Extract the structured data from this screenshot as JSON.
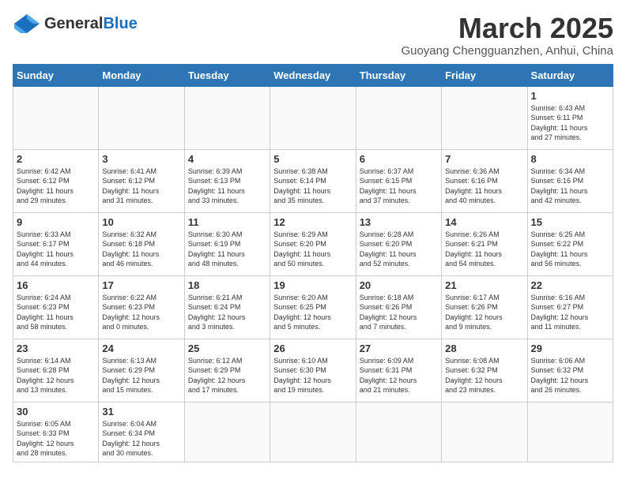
{
  "header": {
    "logo_general": "General",
    "logo_blue": "Blue",
    "month_title": "March 2025",
    "subtitle": "Guoyang Chengguanzhen, Anhui, China"
  },
  "days_of_week": [
    "Sunday",
    "Monday",
    "Tuesday",
    "Wednesday",
    "Thursday",
    "Friday",
    "Saturday"
  ],
  "weeks": [
    [
      {
        "day": "",
        "info": ""
      },
      {
        "day": "",
        "info": ""
      },
      {
        "day": "",
        "info": ""
      },
      {
        "day": "",
        "info": ""
      },
      {
        "day": "",
        "info": ""
      },
      {
        "day": "",
        "info": ""
      },
      {
        "day": "1",
        "info": "Sunrise: 6:43 AM\nSunset: 6:11 PM\nDaylight: 11 hours\nand 27 minutes."
      }
    ],
    [
      {
        "day": "2",
        "info": "Sunrise: 6:42 AM\nSunset: 6:12 PM\nDaylight: 11 hours\nand 29 minutes."
      },
      {
        "day": "3",
        "info": "Sunrise: 6:41 AM\nSunset: 6:12 PM\nDaylight: 11 hours\nand 31 minutes."
      },
      {
        "day": "4",
        "info": "Sunrise: 6:39 AM\nSunset: 6:13 PM\nDaylight: 11 hours\nand 33 minutes."
      },
      {
        "day": "5",
        "info": "Sunrise: 6:38 AM\nSunset: 6:14 PM\nDaylight: 11 hours\nand 35 minutes."
      },
      {
        "day": "6",
        "info": "Sunrise: 6:37 AM\nSunset: 6:15 PM\nDaylight: 11 hours\nand 37 minutes."
      },
      {
        "day": "7",
        "info": "Sunrise: 6:36 AM\nSunset: 6:16 PM\nDaylight: 11 hours\nand 40 minutes."
      },
      {
        "day": "8",
        "info": "Sunrise: 6:34 AM\nSunset: 6:16 PM\nDaylight: 11 hours\nand 42 minutes."
      }
    ],
    [
      {
        "day": "9",
        "info": "Sunrise: 6:33 AM\nSunset: 6:17 PM\nDaylight: 11 hours\nand 44 minutes."
      },
      {
        "day": "10",
        "info": "Sunrise: 6:32 AM\nSunset: 6:18 PM\nDaylight: 11 hours\nand 46 minutes."
      },
      {
        "day": "11",
        "info": "Sunrise: 6:30 AM\nSunset: 6:19 PM\nDaylight: 11 hours\nand 48 minutes."
      },
      {
        "day": "12",
        "info": "Sunrise: 6:29 AM\nSunset: 6:20 PM\nDaylight: 11 hours\nand 50 minutes."
      },
      {
        "day": "13",
        "info": "Sunrise: 6:28 AM\nSunset: 6:20 PM\nDaylight: 11 hours\nand 52 minutes."
      },
      {
        "day": "14",
        "info": "Sunrise: 6:26 AM\nSunset: 6:21 PM\nDaylight: 11 hours\nand 54 minutes."
      },
      {
        "day": "15",
        "info": "Sunrise: 6:25 AM\nSunset: 6:22 PM\nDaylight: 11 hours\nand 56 minutes."
      }
    ],
    [
      {
        "day": "16",
        "info": "Sunrise: 6:24 AM\nSunset: 6:23 PM\nDaylight: 11 hours\nand 58 minutes."
      },
      {
        "day": "17",
        "info": "Sunrise: 6:22 AM\nSunset: 6:23 PM\nDaylight: 12 hours\nand 0 minutes."
      },
      {
        "day": "18",
        "info": "Sunrise: 6:21 AM\nSunset: 6:24 PM\nDaylight: 12 hours\nand 3 minutes."
      },
      {
        "day": "19",
        "info": "Sunrise: 6:20 AM\nSunset: 6:25 PM\nDaylight: 12 hours\nand 5 minutes."
      },
      {
        "day": "20",
        "info": "Sunrise: 6:18 AM\nSunset: 6:26 PM\nDaylight: 12 hours\nand 7 minutes."
      },
      {
        "day": "21",
        "info": "Sunrise: 6:17 AM\nSunset: 6:26 PM\nDaylight: 12 hours\nand 9 minutes."
      },
      {
        "day": "22",
        "info": "Sunrise: 6:16 AM\nSunset: 6:27 PM\nDaylight: 12 hours\nand 11 minutes."
      }
    ],
    [
      {
        "day": "23",
        "info": "Sunrise: 6:14 AM\nSunset: 6:28 PM\nDaylight: 12 hours\nand 13 minutes."
      },
      {
        "day": "24",
        "info": "Sunrise: 6:13 AM\nSunset: 6:29 PM\nDaylight: 12 hours\nand 15 minutes."
      },
      {
        "day": "25",
        "info": "Sunrise: 6:12 AM\nSunset: 6:29 PM\nDaylight: 12 hours\nand 17 minutes."
      },
      {
        "day": "26",
        "info": "Sunrise: 6:10 AM\nSunset: 6:30 PM\nDaylight: 12 hours\nand 19 minutes."
      },
      {
        "day": "27",
        "info": "Sunrise: 6:09 AM\nSunset: 6:31 PM\nDaylight: 12 hours\nand 21 minutes."
      },
      {
        "day": "28",
        "info": "Sunrise: 6:08 AM\nSunset: 6:32 PM\nDaylight: 12 hours\nand 23 minutes."
      },
      {
        "day": "29",
        "info": "Sunrise: 6:06 AM\nSunset: 6:32 PM\nDaylight: 12 hours\nand 26 minutes."
      }
    ],
    [
      {
        "day": "30",
        "info": "Sunrise: 6:05 AM\nSunset: 6:33 PM\nDaylight: 12 hours\nand 28 minutes."
      },
      {
        "day": "31",
        "info": "Sunrise: 6:04 AM\nSunset: 6:34 PM\nDaylight: 12 hours\nand 30 minutes."
      },
      {
        "day": "",
        "info": ""
      },
      {
        "day": "",
        "info": ""
      },
      {
        "day": "",
        "info": ""
      },
      {
        "day": "",
        "info": ""
      },
      {
        "day": "",
        "info": ""
      }
    ]
  ]
}
